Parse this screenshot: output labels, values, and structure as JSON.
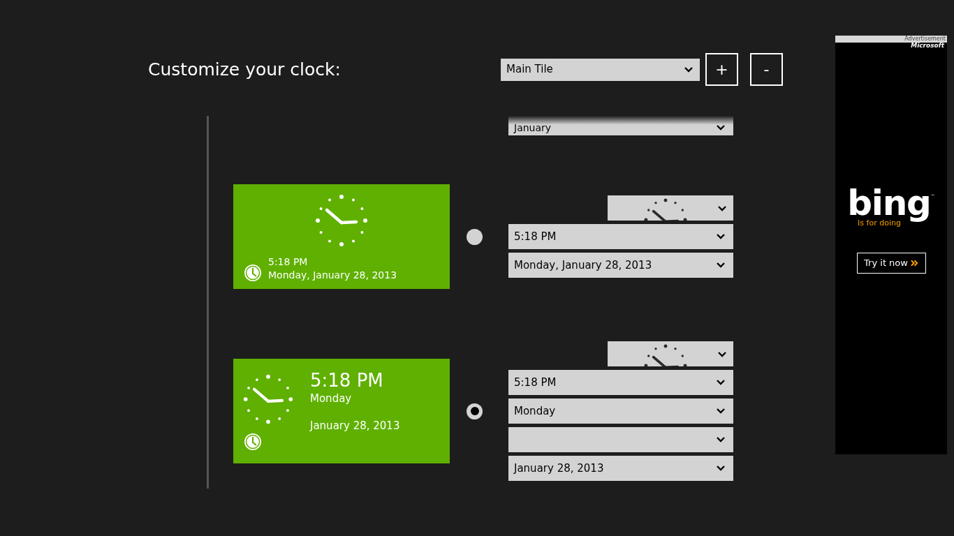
{
  "title": "Customize your clock:",
  "tile_select": {
    "value": "Main Tile"
  },
  "buttons": [
    {
      "label": "+"
    },
    {
      "label": "-"
    }
  ],
  "month_select": {
    "value": "January"
  },
  "options": [
    {
      "selected": false,
      "tile": {
        "kind": "compact",
        "time": "5:18 PM",
        "date": "Monday, January 28, 2013"
      },
      "selects": [
        {
          "kind": "clock"
        },
        {
          "kind": "text",
          "value": "5:18 PM"
        },
        {
          "kind": "text",
          "value": "Monday, January 28, 2013"
        }
      ]
    },
    {
      "selected": true,
      "tile": {
        "kind": "large",
        "time": "5:18 PM",
        "day": "Monday",
        "date": "January 28, 2013"
      },
      "selects": [
        {
          "kind": "clock"
        },
        {
          "kind": "text",
          "value": "5:18 PM"
        },
        {
          "kind": "text",
          "value": "Monday"
        },
        {
          "kind": "text"
        },
        {
          "kind": "text",
          "value": "January 28, 2013"
        }
      ]
    }
  ],
  "ad": {
    "label": "Advertisement",
    "brand": "Microsoft",
    "logo": "bing",
    "logo_mark": "™",
    "tagline": "Is for doing",
    "button": "Try it now"
  }
}
